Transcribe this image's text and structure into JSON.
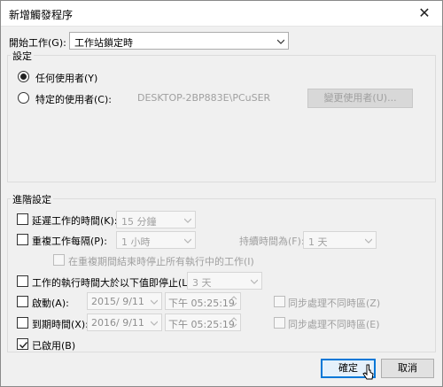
{
  "window": {
    "title": "新增觸發程序",
    "close_glyph": "✕"
  },
  "start_task": {
    "label": "開始工作(G):",
    "value": "工作站鎖定時"
  },
  "settings": {
    "group_title": "設定",
    "any_user_label": "任何使用者(Y)",
    "specific_user_label": "特定的使用者(C):",
    "user_value": "DESKTOP-2BP883E\\PCuSER",
    "change_user_button": "變更使用者(U)...",
    "selected": "any_user"
  },
  "advanced": {
    "group_title": "進階設定",
    "delay": {
      "label": "延遲工作的時間(K):",
      "value": "15 分鐘",
      "checked": false
    },
    "repeat": {
      "label": "重複工作每隔(P):",
      "value": "1 小時",
      "checked": false,
      "duration_label": "持續時間為(F):",
      "duration_value": "1 天"
    },
    "stop_running": {
      "label": "在重複期間結束時停止所有執行中的工作(I)",
      "checked": false
    },
    "stop_longer": {
      "label": "工作的執行時間大於以下值即停止(L):",
      "value": "3 天",
      "checked": false
    },
    "activate": {
      "label": "啟動(A):",
      "date": "2015/  9/11",
      "time": "下午 05:25:19",
      "sync_label": "同步處理不同時區(Z)",
      "checked": false
    },
    "expire": {
      "label": "到期時間(X):",
      "date": "2016/  9/11",
      "time": "下午 05:25:19",
      "sync_label": "同步處理不同時區(E)",
      "checked": false
    },
    "enabled": {
      "label": "已啟用(B)",
      "checked": true
    }
  },
  "buttons": {
    "ok": "確定",
    "cancel": "取消"
  }
}
